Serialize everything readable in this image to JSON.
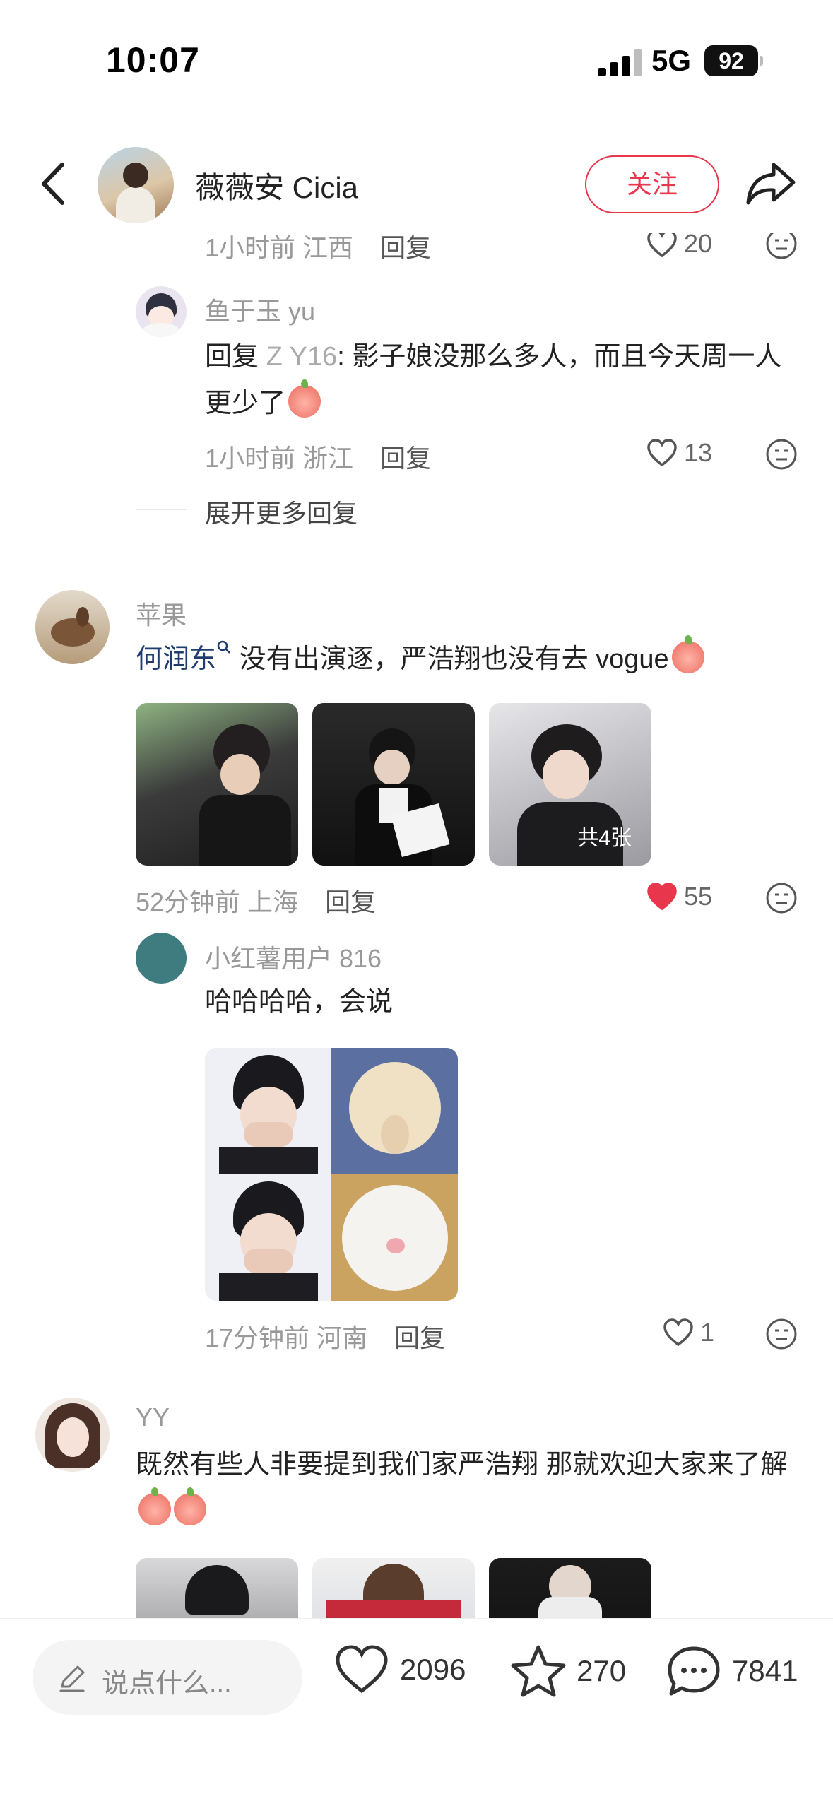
{
  "status_bar": {
    "time": "10:07",
    "network": "5G",
    "battery": "92"
  },
  "header": {
    "name": "薇薇安 Cicia",
    "follow_label": "关注"
  },
  "comments": [
    {
      "partial_meta": {
        "time": "1小时前",
        "location": "江西",
        "reply_label": "回复",
        "likes": "20"
      },
      "reply": {
        "name": "鱼于玉 yu",
        "prefix": "回复",
        "mention": "Z Y16",
        "text": ": 影子娘没那么多人，而且今天周一人更少了",
        "time": "1小时前",
        "location": "浙江",
        "reply_label": "回复",
        "likes": "13"
      },
      "expand_label": "展开更多回复"
    },
    {
      "name": "苹果",
      "mention": "何润东",
      "text": "没有出演逐",
      "text_tail": "，严浩翔也没有去 vogue",
      "images_badge": "共4张",
      "time": "52分钟前",
      "location": "上海",
      "reply_label": "回复",
      "likes": "55",
      "liked": true,
      "reply": {
        "name": "小红薯用户 816",
        "text": "哈哈哈哈，会说",
        "time": "17分钟前",
        "location": "河南",
        "reply_label": "回复",
        "likes": "1"
      }
    },
    {
      "name": "YY",
      "text": "既然有些人非要提到我们家严浩翔 那就欢迎大家来了解"
    }
  ],
  "bottom_bar": {
    "input_placeholder": "说点什么...",
    "likes": "2096",
    "favorites": "270",
    "comments": "7841"
  },
  "colors": {
    "accent": "#e8374d",
    "like_red": "#e8374d",
    "mention_blue": "#1e3d6e"
  },
  "icons": [
    "back-icon",
    "share-icon",
    "heart-icon",
    "dislike-face-icon",
    "star-icon",
    "comment-bubble-icon",
    "pen-icon",
    "signal-icon",
    "battery-icon",
    "search-icon"
  ]
}
